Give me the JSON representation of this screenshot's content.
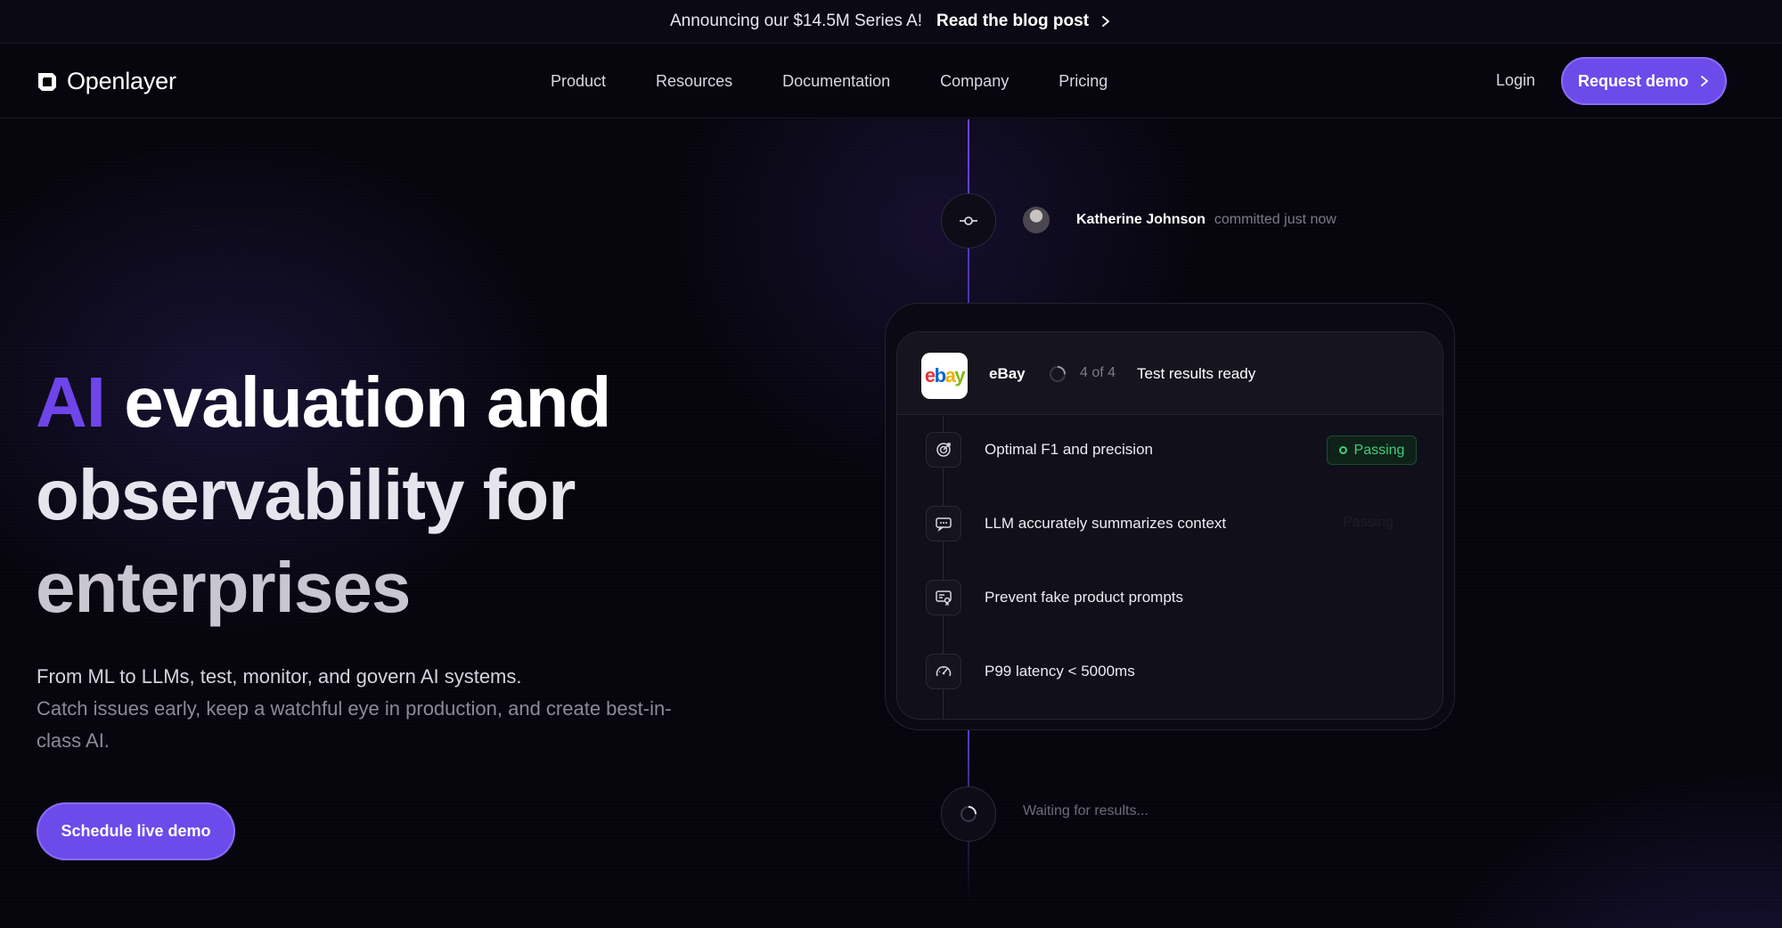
{
  "announcement": {
    "message": "Announcing our $14.5M Series A!",
    "link_label": "Read the blog post"
  },
  "nav": {
    "brand": "Openlayer",
    "links": [
      "Product",
      "Resources",
      "Documentation",
      "Company",
      "Pricing"
    ],
    "login_label": "Login",
    "demo_label": "Request demo"
  },
  "hero": {
    "headline_accent": "AI",
    "headline_line1": " evaluation and",
    "headline_line2": "observability for",
    "headline_line3": "enterprises",
    "sub_line1": "From ML to LLMs, test, monitor, and govern AI systems.",
    "sub_line2": "Catch issues early, keep a watchful eye in production, and create best-in-class AI.",
    "cta_label": "Schedule live demo"
  },
  "timeline": {
    "commit_author": "Katherine Johnson",
    "commit_time": "committed just now",
    "waiting_label": "Waiting for results..."
  },
  "card": {
    "org_name": "eBay",
    "logo_letters": [
      "e",
      "b",
      "a",
      "y"
    ],
    "progress": "4 of 4",
    "status": "Test results ready",
    "tests": [
      {
        "label": "Optimal F1 and precision",
        "icon": "target-icon",
        "badge": "Passing"
      },
      {
        "label": "LLM accurately summarizes context",
        "icon": "chat-bubble-icon",
        "badge": "Passing"
      },
      {
        "label": "Prevent fake product prompts",
        "icon": "certificate-icon",
        "badge": ""
      },
      {
        "label": "P99 latency < 5000ms",
        "icon": "speedometer-icon",
        "badge": ""
      }
    ]
  },
  "colors": {
    "accent": "#6c4bea",
    "background": "#06050d",
    "passing": "#3ecf7a"
  }
}
